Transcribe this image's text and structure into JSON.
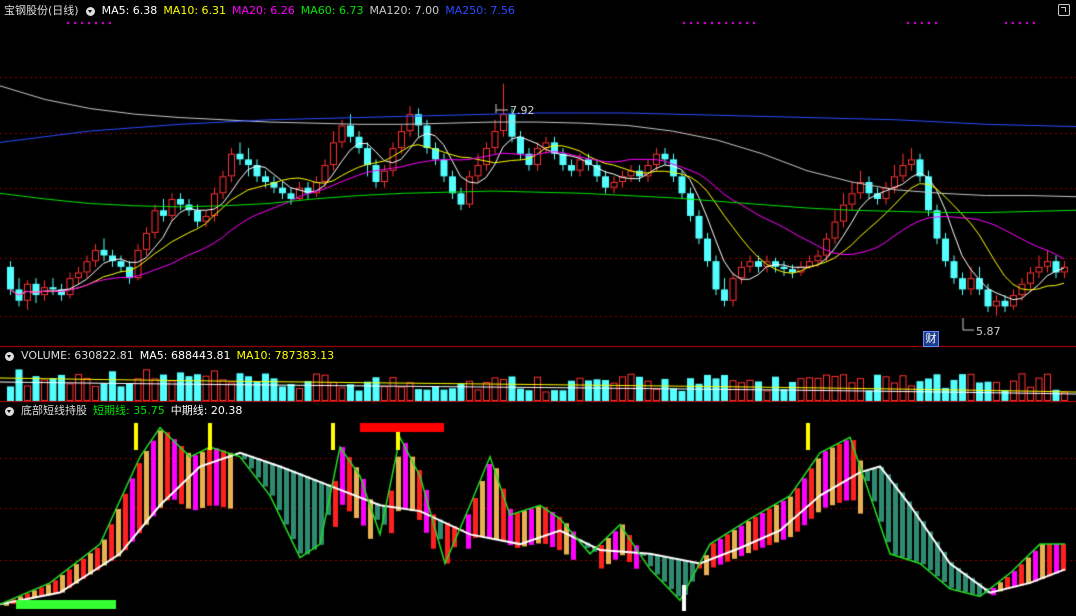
{
  "main_legend": {
    "title": "宝钢股份(日线)",
    "ma5": "MA5: 6.38",
    "ma10": "MA10: 6.31",
    "ma20": "MA20: 6.26",
    "ma60": "MA60: 6.73",
    "ma120": "MA120: 7.00",
    "ma250": "MA250: 7.56"
  },
  "volume_legend": {
    "volume": "VOLUME: 630822.81",
    "ma5": "MA5: 688443.81",
    "ma10": "MA10: 787383.13"
  },
  "indicator_legend": {
    "title": "底部短线持股",
    "short": "短期线: 35.75",
    "mid": "中期线: 20.38"
  },
  "annotations": {
    "high_label": "7.92",
    "low_label": "5.87",
    "cai_badge": "财"
  },
  "colors": {
    "background": "#000000",
    "up": "#ff3232",
    "down": "#54ffff",
    "ma5": "#ffffff",
    "ma10": "#ffff00",
    "ma20": "#ff00ff",
    "ma60": "#00e600",
    "ma120": "#c8c8c8",
    "ma250": "#2b4bff",
    "grid": "#8b0000"
  },
  "chart_data": {
    "type": "candlestick",
    "price_range": [
      5.6,
      8.5
    ],
    "high": 7.92,
    "low": 5.87,
    "candles": [
      [
        6.3,
        6.1,
        6.35,
        6.05
      ],
      [
        6.1,
        6.0,
        6.2,
        5.95
      ],
      [
        6.0,
        6.15,
        6.18,
        5.92
      ],
      [
        6.15,
        6.05,
        6.2,
        5.98
      ],
      [
        6.05,
        6.12,
        6.18,
        6.0
      ],
      [
        6.12,
        6.1,
        6.2,
        6.05
      ],
      [
        6.1,
        6.05,
        6.15,
        6.0
      ],
      [
        6.05,
        6.2,
        6.25,
        6.02
      ],
      [
        6.2,
        6.25,
        6.3,
        6.15
      ],
      [
        6.25,
        6.35,
        6.4,
        6.2
      ],
      [
        6.35,
        6.45,
        6.5,
        6.3
      ],
      [
        6.45,
        6.4,
        6.55,
        6.35
      ],
      [
        6.4,
        6.35,
        6.45,
        6.3
      ],
      [
        6.35,
        6.3,
        6.4,
        6.25
      ],
      [
        6.3,
        6.2,
        6.35,
        6.15
      ],
      [
        6.2,
        6.45,
        6.5,
        6.18
      ],
      [
        6.45,
        6.6,
        6.65,
        6.4
      ],
      [
        6.6,
        6.8,
        6.85,
        6.55
      ],
      [
        6.8,
        6.75,
        6.9,
        6.7
      ],
      [
        6.75,
        6.9,
        6.95,
        6.7
      ],
      [
        6.9,
        6.85,
        6.95,
        6.8
      ],
      [
        6.85,
        6.8,
        6.9,
        6.75
      ],
      [
        6.8,
        6.7,
        6.85,
        6.65
      ],
      [
        6.7,
        6.75,
        6.8,
        6.65
      ],
      [
        6.75,
        6.95,
        7.0,
        6.7
      ],
      [
        6.95,
        7.1,
        7.15,
        6.9
      ],
      [
        7.1,
        7.3,
        7.35,
        7.05
      ],
      [
        7.3,
        7.25,
        7.4,
        7.2
      ],
      [
        7.25,
        7.2,
        7.35,
        7.1
      ],
      [
        7.2,
        7.1,
        7.25,
        7.05
      ],
      [
        7.1,
        7.05,
        7.15,
        7.0
      ],
      [
        7.05,
        7.0,
        7.1,
        6.95
      ],
      [
        7.0,
        6.95,
        7.05,
        6.9
      ],
      [
        6.95,
        6.9,
        7.0,
        6.85
      ],
      [
        6.9,
        7.0,
        7.05,
        6.88
      ],
      [
        7.0,
        6.95,
        7.05,
        6.9
      ],
      [
        6.95,
        7.05,
        7.1,
        6.92
      ],
      [
        7.05,
        7.2,
        7.25,
        7.0
      ],
      [
        7.2,
        7.4,
        7.5,
        7.15
      ],
      [
        7.4,
        7.55,
        7.6,
        7.35
      ],
      [
        7.55,
        7.45,
        7.65,
        7.4
      ],
      [
        7.45,
        7.35,
        7.5,
        7.3
      ],
      [
        7.35,
        7.2,
        7.4,
        7.1
      ],
      [
        7.2,
        7.05,
        7.25,
        7.0
      ],
      [
        7.05,
        7.15,
        7.2,
        7.0
      ],
      [
        7.15,
        7.35,
        7.4,
        7.1
      ],
      [
        7.35,
        7.5,
        7.55,
        7.3
      ],
      [
        7.5,
        7.65,
        7.72,
        7.45
      ],
      [
        7.65,
        7.55,
        7.7,
        7.45
      ],
      [
        7.55,
        7.35,
        7.6,
        7.3
      ],
      [
        7.35,
        7.25,
        7.4,
        7.2
      ],
      [
        7.25,
        7.1,
        7.3,
        7.05
      ],
      [
        7.1,
        6.95,
        7.15,
        6.9
      ],
      [
        6.95,
        6.85,
        7.0,
        6.8
      ],
      [
        6.85,
        7.1,
        7.15,
        6.82
      ],
      [
        7.1,
        7.2,
        7.3,
        7.05
      ],
      [
        7.2,
        7.35,
        7.4,
        7.15
      ],
      [
        7.35,
        7.5,
        7.6,
        7.3
      ],
      [
        7.5,
        7.65,
        7.92,
        7.45
      ],
      [
        7.65,
        7.45,
        7.7,
        7.4
      ],
      [
        7.45,
        7.3,
        7.5,
        7.25
      ],
      [
        7.3,
        7.2,
        7.35,
        7.15
      ],
      [
        7.2,
        7.35,
        7.4,
        7.15
      ],
      [
        7.35,
        7.4,
        7.45,
        7.3
      ],
      [
        7.4,
        7.3,
        7.45,
        7.25
      ],
      [
        7.3,
        7.2,
        7.35,
        7.15
      ],
      [
        7.2,
        7.15,
        7.25,
        7.1
      ],
      [
        7.15,
        7.25,
        7.3,
        7.1
      ],
      [
        7.25,
        7.2,
        7.3,
        7.15
      ],
      [
        7.2,
        7.1,
        7.25,
        7.05
      ],
      [
        7.1,
        7.0,
        7.15,
        6.95
      ],
      [
        7.0,
        7.05,
        7.1,
        6.95
      ],
      [
        7.05,
        7.1,
        7.15,
        7.0
      ],
      [
        7.1,
        7.15,
        7.2,
        7.05
      ],
      [
        7.15,
        7.1,
        7.2,
        7.05
      ],
      [
        7.1,
        7.2,
        7.25,
        7.05
      ],
      [
        7.2,
        7.3,
        7.35,
        7.15
      ],
      [
        7.3,
        7.25,
        7.35,
        7.2
      ],
      [
        7.25,
        7.1,
        7.3,
        7.05
      ],
      [
        7.1,
        6.95,
        7.15,
        6.9
      ],
      [
        6.95,
        6.75,
        7.0,
        6.7
      ],
      [
        6.75,
        6.55,
        6.8,
        6.5
      ],
      [
        6.55,
        6.35,
        6.6,
        6.3
      ],
      [
        6.35,
        6.1,
        6.4,
        6.05
      ],
      [
        6.1,
        6.0,
        6.2,
        5.95
      ],
      [
        6.0,
        6.2,
        6.25,
        5.95
      ],
      [
        6.2,
        6.3,
        6.35,
        6.15
      ],
      [
        6.3,
        6.35,
        6.4,
        6.25
      ],
      [
        6.35,
        6.3,
        6.4,
        6.25
      ],
      [
        6.3,
        6.35,
        6.4,
        6.25
      ],
      [
        6.35,
        6.3,
        6.38,
        6.25
      ],
      [
        6.3,
        6.28,
        6.35,
        6.22
      ],
      [
        6.28,
        6.25,
        6.32,
        6.2
      ],
      [
        6.25,
        6.3,
        6.35,
        6.22
      ],
      [
        6.3,
        6.35,
        6.4,
        6.28
      ],
      [
        6.35,
        6.4,
        6.45,
        6.3
      ],
      [
        6.4,
        6.55,
        6.6,
        6.35
      ],
      [
        6.55,
        6.7,
        6.8,
        6.5
      ],
      [
        6.7,
        6.85,
        6.95,
        6.65
      ],
      [
        6.85,
        6.95,
        7.05,
        6.8
      ],
      [
        6.95,
        7.05,
        7.15,
        6.9
      ],
      [
        7.05,
        6.95,
        7.1,
        6.9
      ],
      [
        6.95,
        6.9,
        7.0,
        6.85
      ],
      [
        6.9,
        7.0,
        7.05,
        6.85
      ],
      [
        7.0,
        7.1,
        7.2,
        6.95
      ],
      [
        7.1,
        7.2,
        7.3,
        7.05
      ],
      [
        7.2,
        7.25,
        7.35,
        7.15
      ],
      [
        7.25,
        7.1,
        7.3,
        7.05
      ],
      [
        7.1,
        6.8,
        7.15,
        6.75
      ],
      [
        6.8,
        6.55,
        6.85,
        6.5
      ],
      [
        6.55,
        6.35,
        6.6,
        6.3
      ],
      [
        6.35,
        6.2,
        6.4,
        6.15
      ],
      [
        6.2,
        6.1,
        6.25,
        6.05
      ],
      [
        6.1,
        6.2,
        6.3,
        6.05
      ],
      [
        6.2,
        6.1,
        6.3,
        6.05
      ],
      [
        6.1,
        5.95,
        6.15,
        5.9
      ],
      [
        5.95,
        6.0,
        6.05,
        5.87
      ],
      [
        6.0,
        5.95,
        6.05,
        5.9
      ],
      [
        5.95,
        6.05,
        6.1,
        5.92
      ],
      [
        6.05,
        6.15,
        6.2,
        6.0
      ],
      [
        6.15,
        6.25,
        6.3,
        6.1
      ],
      [
        6.25,
        6.3,
        6.4,
        6.2
      ],
      [
        6.3,
        6.35,
        6.45,
        6.25
      ],
      [
        6.35,
        6.25,
        6.4,
        6.2
      ],
      [
        6.25,
        6.3,
        6.35,
        6.2
      ]
    ],
    "mas": {
      "ma60": [
        6.95,
        6.9,
        6.86,
        6.84,
        6.83,
        6.84,
        6.86,
        6.9,
        6.93,
        6.95,
        6.96,
        6.97,
        6.96,
        6.95,
        6.93,
        6.91,
        6.88,
        6.85,
        6.82,
        6.8,
        6.79,
        6.78,
        6.78,
        6.79,
        6.8
      ],
      "ma120": [
        7.9,
        7.78,
        7.7,
        7.65,
        7.62,
        7.6,
        7.58,
        7.57,
        7.56,
        7.56,
        7.57,
        7.58,
        7.58,
        7.57,
        7.55,
        7.5,
        7.42,
        7.3,
        7.15,
        7.05,
        6.98,
        6.95,
        6.93,
        6.93,
        6.92
      ],
      "ma250": [
        7.4,
        7.45,
        7.5,
        7.53,
        7.56,
        7.58,
        7.6,
        7.61,
        7.62,
        7.63,
        7.64,
        7.65,
        7.66,
        7.66,
        7.66,
        7.65,
        7.64,
        7.63,
        7.62,
        7.61,
        7.6,
        7.58,
        7.56,
        7.55,
        7.54
      ]
    },
    "volume_max": 1400000,
    "indicator_range": [
      0,
      100
    ]
  }
}
